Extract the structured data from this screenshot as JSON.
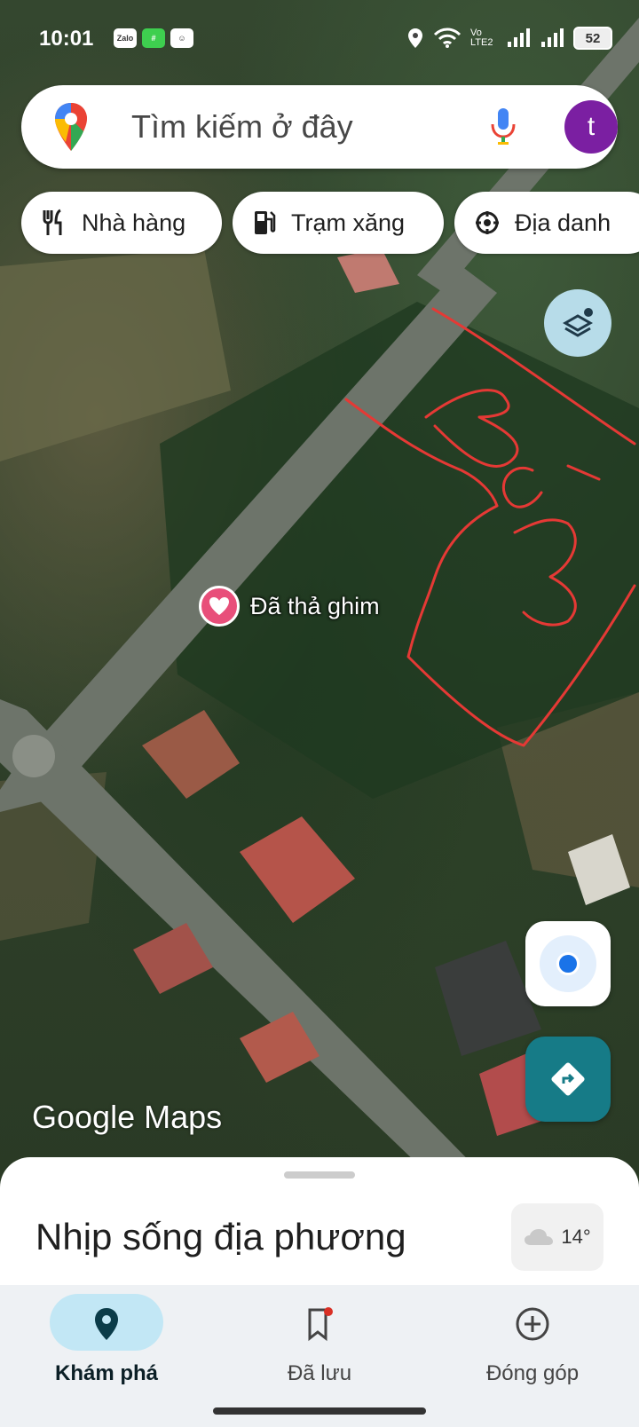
{
  "status_bar": {
    "time": "10:01",
    "apps": [
      "Zalo",
      "#",
      "☺"
    ],
    "network": "Vo LTE2",
    "battery": "52"
  },
  "search": {
    "placeholder": "Tìm kiếm ở đây",
    "avatar_letter": "t",
    "avatar_color": "#7b1fa2"
  },
  "chips": [
    {
      "label": "Nhà hàng",
      "icon": "fork-knife-icon"
    },
    {
      "label": "Trạm xăng",
      "icon": "gas-station-icon"
    },
    {
      "label": "Địa danh",
      "icon": "landmark-icon"
    }
  ],
  "map": {
    "pin_label": "Đã thả ghim",
    "brand": "Google Maps",
    "annotation_text": "BGM"
  },
  "sheet": {
    "title": "Nhịp sống địa phương",
    "weather_temp": "14°"
  },
  "nav": {
    "items": [
      {
        "label": "Khám phá",
        "icon": "explore-pin-icon",
        "active": true
      },
      {
        "label": "Đã lưu",
        "icon": "bookmark-icon",
        "active": false,
        "badge": true
      },
      {
        "label": "Đóng góp",
        "icon": "add-circle-icon",
        "active": false
      }
    ]
  },
  "colors": {
    "accent_active": "#c2e7f5",
    "direction_button": "#167b87",
    "annotation_red": "#e53935",
    "pin_heart": "#e84f7a"
  }
}
